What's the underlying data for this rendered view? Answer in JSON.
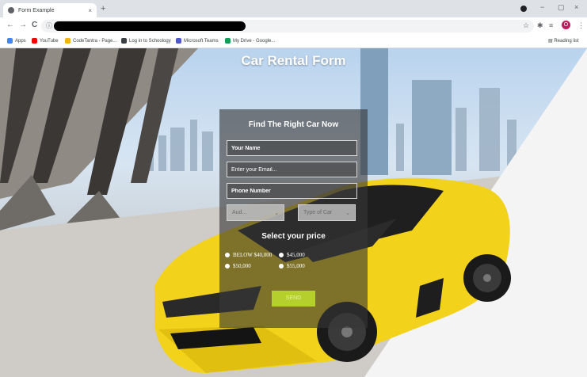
{
  "browser": {
    "tab_title": "Form Example",
    "tab_close": "×",
    "new_tab": "+",
    "win_minimize": "−",
    "win_maximize": "▢",
    "win_close": "×",
    "nav_back": "←",
    "nav_forward": "→",
    "nav_reload": "C",
    "avatar_letter": "O",
    "bookmarks": [
      {
        "label": "Apps",
        "color": "#4285f4"
      },
      {
        "label": "YouTube",
        "color": "#ff0000"
      },
      {
        "label": "CodeTantra - Page...",
        "color": "#f4b400"
      },
      {
        "label": "Log in to Schoology",
        "color": "#3c4043"
      },
      {
        "label": "Microsoft Teams",
        "color": "#5059c9"
      },
      {
        "label": "My Drive - Google...",
        "color": "#0f9d58"
      }
    ],
    "reading_list": "Reading list"
  },
  "page": {
    "title": "Car Rental Form",
    "form": {
      "heading": "Find The Right Car Now",
      "name_placeholder": "Your Name",
      "email_placeholder": "Enter your Email...",
      "phone_placeholder": "Phone Number",
      "select_brand": "Aud...",
      "select_type": "Type of Car",
      "price_heading": "Select your price",
      "price_options": [
        "BELOW $40,000",
        "$45,000",
        "$50,000",
        "$55,000"
      ],
      "send_label": "SEND"
    }
  },
  "colors": {
    "car_yellow": "#f2d21a",
    "send_button": "#b5d02c",
    "card_overlay": "rgba(55,55,55,0.62)"
  }
}
